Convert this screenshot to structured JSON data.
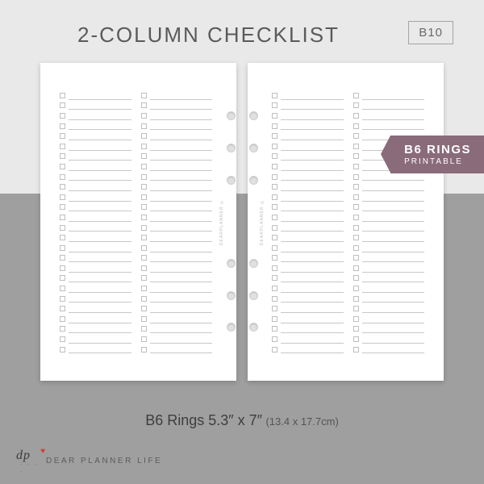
{
  "title": "2-COLUMN CHECKLIST",
  "sku": "B10",
  "ribbon": {
    "title": "B6 RINGS",
    "sub": "PRINTABLE"
  },
  "size": {
    "main": "B6 Rings 5.3″ x 7″",
    "sub": "(13.4 x 17.7cm)"
  },
  "watermark": "DEARPLANNER ©",
  "brand": {
    "initials": "dp",
    "name": "DEAR PLANNER LIFE"
  },
  "checklist": {
    "rows_per_column": 26,
    "columns_per_page": 2,
    "pages": 2,
    "holes_per_page": 6
  }
}
